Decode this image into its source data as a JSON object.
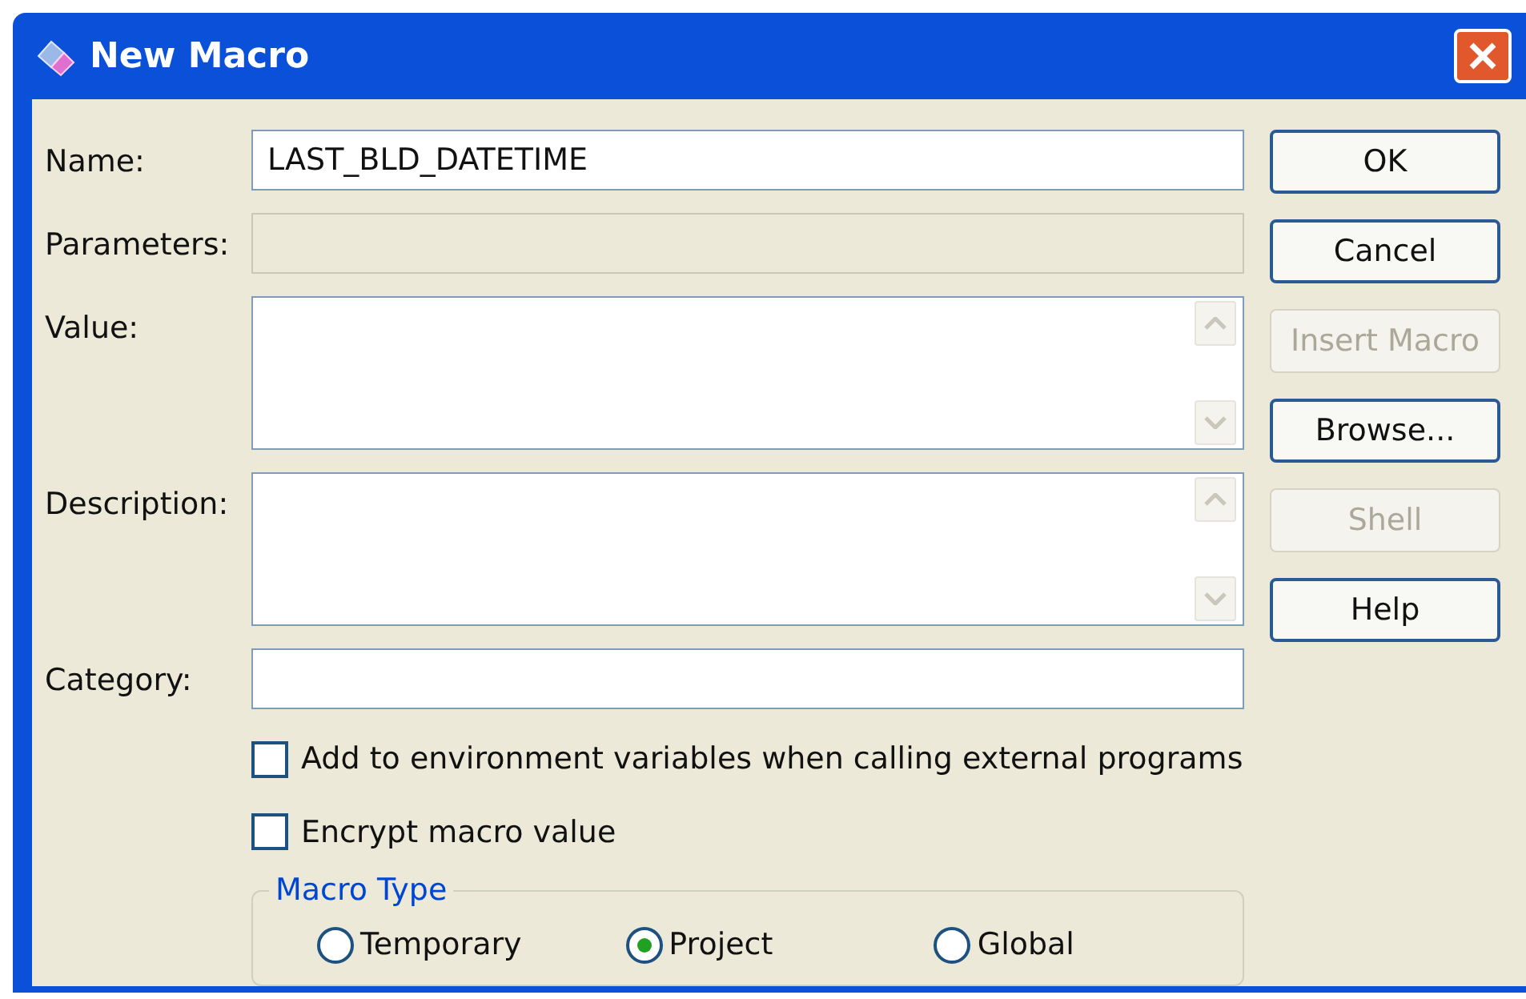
{
  "window": {
    "title": "New Macro"
  },
  "fields": [
    {
      "label": "Name:",
      "kind": "line",
      "value": "LAST_BLD_DATETIME",
      "disabled": false
    },
    {
      "label": "Parameters:",
      "kind": "line",
      "disabled": true
    },
    {
      "label": "Value:",
      "kind": "multiline",
      "disabled": false
    },
    {
      "label": "Description:",
      "kind": "multiline",
      "disabled": false
    },
    {
      "label": "Category:",
      "kind": "line",
      "disabled": false
    }
  ],
  "checkboxes": [
    {
      "label": "Add to environment variables when calling external programs",
      "checked": false
    },
    {
      "label": "Encrypt macro value",
      "checked": false
    }
  ],
  "macro_type": {
    "title": "Macro Type",
    "options": [
      {
        "label": "Temporary",
        "selected": false
      },
      {
        "label": "Project",
        "selected": true
      },
      {
        "label": "Global",
        "selected": false
      }
    ]
  },
  "buttons": [
    {
      "label": "OK",
      "disabled": false
    },
    {
      "label": "Cancel",
      "disabled": false
    },
    {
      "label": "Insert Macro",
      "disabled": true
    },
    {
      "label": "Browse...",
      "disabled": false
    },
    {
      "label": "Shell",
      "disabled": true
    },
    {
      "label": "Help",
      "disabled": false
    }
  ]
}
